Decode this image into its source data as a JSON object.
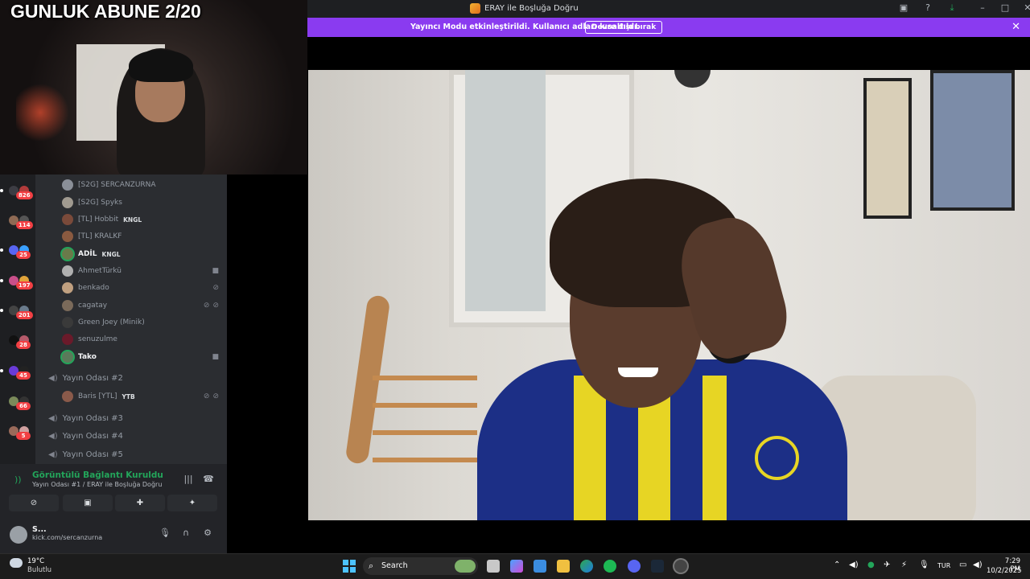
{
  "window": {
    "title": "ERAY ile Boşluğa Doğru"
  },
  "banner": {
    "message": "Yayıncı Modu etkinleştirildi. Kullanıcı adları kısaltıldı.",
    "button": "Devre dışı bırak"
  },
  "overlay": {
    "sub_goal": "GUNLUK ABUNE 2/20"
  },
  "servers": [
    {
      "badge": "826"
    },
    {
      "badge": "114"
    },
    {
      "badge": "25"
    },
    {
      "badge": "197"
    },
    {
      "badge": "201"
    },
    {
      "badge": "28"
    },
    {
      "badge": "45"
    },
    {
      "badge": "66"
    },
    {
      "badge": "5"
    }
  ],
  "members": [
    {
      "name": "[S2G] SERCANZURNA",
      "tag": ""
    },
    {
      "name": "[S2G] Spyks",
      "tag": ""
    },
    {
      "name": "[TL] Hobbit",
      "tag": "KNGL"
    },
    {
      "name": "[TL] KRALKF",
      "tag": ""
    },
    {
      "name": "ADİL",
      "tag": "KNGL"
    },
    {
      "name": "AhmetTürkü",
      "tag": ""
    },
    {
      "name": "benkado",
      "tag": ""
    },
    {
      "name": "cagatay",
      "tag": ""
    },
    {
      "name": "Green Joey (Minik)",
      "tag": ""
    },
    {
      "name": "senuzulme",
      "tag": ""
    },
    {
      "name": "Tako",
      "tag": ""
    }
  ],
  "voice_channels": {
    "room2": "Yayın Odası #2",
    "room2_member": {
      "name": "Baris [YTL]",
      "tag": "YTB"
    },
    "room3": "Yayın Odası #3",
    "room4": "Yayın Odası #4",
    "room5": "Yayın Odası #5"
  },
  "voice_panel": {
    "status": "Görüntülü Bağlantı Kuruldu",
    "channel": "Yayın Odası #1 / ERAY ile Boşluğa Doğru"
  },
  "user_panel": {
    "name": "S...",
    "status": "kick.com/sercanzurna"
  },
  "taskbar": {
    "weather_temp": "19°C",
    "weather_desc": "Bulutlu",
    "search_placeholder": "Search",
    "language": "TUR",
    "time": "7:29 PM",
    "date": "10/2/2025"
  },
  "colors": {
    "accent": "#8a3bf0",
    "connected": "#23a55a",
    "badge": "#f23f43"
  }
}
